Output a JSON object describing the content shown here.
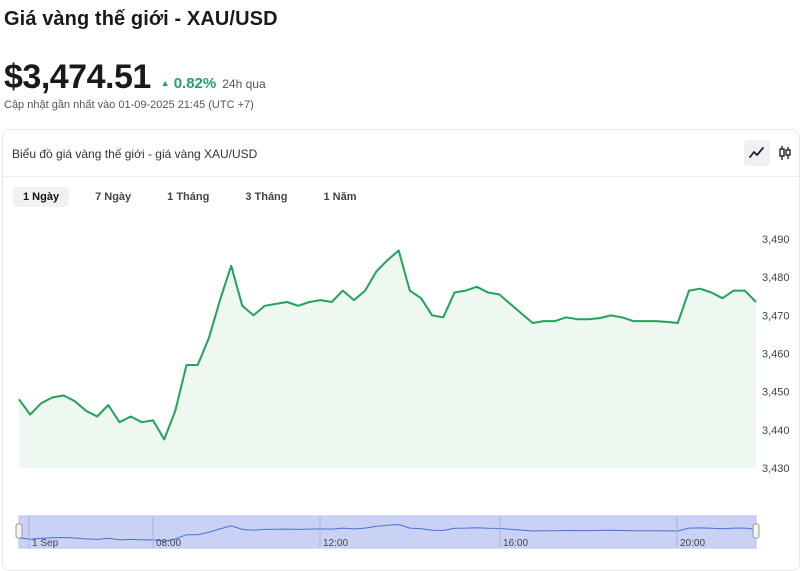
{
  "header": {
    "title": "Giá vàng thế giới - XAU/USD",
    "price": "$3,474.51",
    "change": "0.82%",
    "change_period": "24h qua",
    "updated": "Cập nhật gần nhất vào 01-09-2025 21:45 (UTC +7)"
  },
  "card": {
    "title": "Biểu đồ giá vàng thế giới - giá vàng XAU/USD",
    "view_buttons": [
      {
        "name": "line-chart-icon"
      },
      {
        "name": "candlestick-icon"
      }
    ],
    "tabs": [
      {
        "label": "1 Ngày",
        "active": true
      },
      {
        "label": "7 Ngày",
        "active": false
      },
      {
        "label": "1 Tháng",
        "active": false
      },
      {
        "label": "3 Tháng",
        "active": false
      },
      {
        "label": "1 Năm",
        "active": false
      }
    ]
  },
  "colors": {
    "up": "#21a366",
    "line": "#22a35a",
    "area": "#eef7f0",
    "navigator_fill": "#c9d1f5",
    "navigator_line": "#4a6fd6"
  },
  "chart_data": {
    "type": "area",
    "ylim": [
      3430,
      3495
    ],
    "y_ticks": [
      "3,490",
      "3,480",
      "3,470",
      "3,460",
      "3,450",
      "3,440",
      "3,430"
    ],
    "y_tick_values": [
      3490,
      3480,
      3470,
      3460,
      3450,
      3440,
      3430
    ],
    "grid": false,
    "series": [
      {
        "values": [
          3448,
          3444,
          3447,
          3448.5,
          3449,
          3447.5,
          3445,
          3443.5,
          3446.5,
          3442,
          3443.5,
          3442,
          3442.5,
          3437.5,
          3445,
          3457,
          3457,
          3464,
          3474,
          3483,
          3472.5,
          3470,
          3472.5,
          3473,
          3473.5,
          3472.5,
          3473.5,
          3474,
          3473.5,
          3476.5,
          3474,
          3476.5,
          3481.5,
          3484.5,
          3487,
          3476.5,
          3474.5,
          3470,
          3469.5,
          3476,
          3476.5,
          3477.5,
          3476,
          3475.5,
          3473,
          3470.5,
          3468,
          3468.5,
          3468.5,
          3469.5,
          3469,
          3469,
          3469.3,
          3470,
          3469.5,
          3468.5,
          3468.5,
          3468.5,
          3468.3,
          3468,
          3476.5,
          3477,
          3476,
          3474.5,
          3476.5,
          3476.5,
          3473.5
        ]
      }
    ],
    "navigator_ticks": [
      "1 Sep",
      "08:00",
      "12:00",
      "16:00",
      "20:00"
    ]
  }
}
